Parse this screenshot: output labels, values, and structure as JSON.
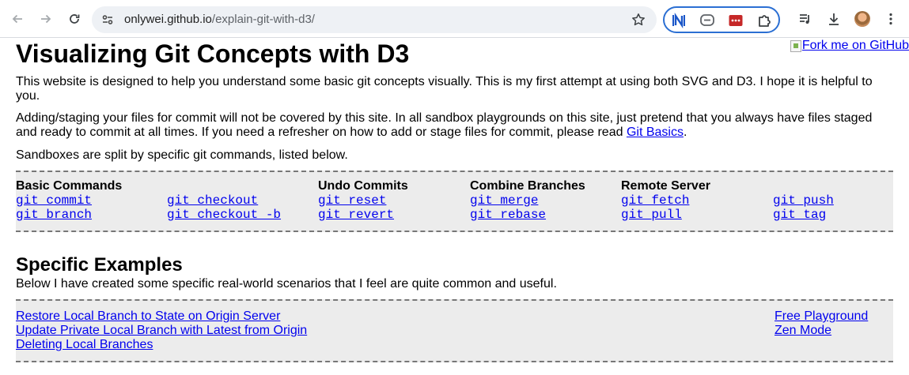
{
  "browser": {
    "url_host": "onlywei.github.io",
    "url_path": "/explain-git-with-d3/"
  },
  "page": {
    "fork_text": "Fork me on GitHub",
    "title": "Visualizing Git Concepts with D3",
    "intro": "This website is designed to help you understand some basic git concepts visually. This is my first attempt at using both SVG and D3. I hope it is helpful to you.",
    "staging_text_before": "Adding/staging your files for commit will not be covered by this site. In all sandbox playgrounds on this site, just pretend that you always have files staged and ready to commit at all times. If you need a refresher on how to add or stage files for commit, please read ",
    "staging_link": "Git Basics",
    "staging_text_after": ".",
    "sandboxes_text": "Sandboxes are split by specific git commands, listed below.",
    "commands": {
      "basic_heading": "Basic Commands",
      "undo_heading": "Undo Commits",
      "combine_heading": "Combine Branches",
      "remote_heading": "Remote Server",
      "git_commit": "git commit",
      "git_branch": "git branch",
      "git_checkout": "git checkout",
      "git_checkout_b": "git checkout -b",
      "git_reset": "git reset",
      "git_revert": "git revert",
      "git_merge": "git merge",
      "git_rebase": "git rebase",
      "git_fetch": "git fetch",
      "git_pull": "git pull",
      "git_push": "git push",
      "git_tag": "git tag"
    },
    "examples_heading": "Specific Examples",
    "examples_intro": "Below I have created some specific real-world scenarios that I feel are quite common and useful.",
    "examples": {
      "restore": "Restore Local Branch to State on Origin Server",
      "update": "Update Private Local Branch with Latest from Origin",
      "deleting": "Deleting Local Branches",
      "free_playground": "Free Playground",
      "zen_mode": "Zen Mode"
    }
  }
}
